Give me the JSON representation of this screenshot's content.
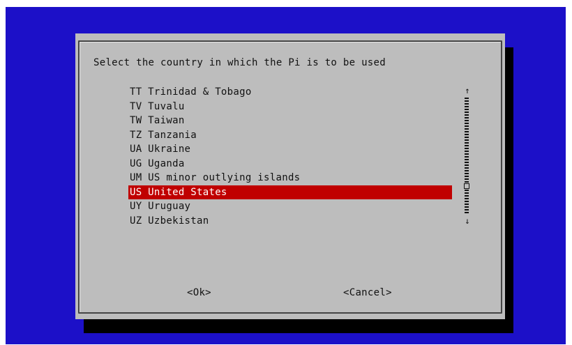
{
  "dialog": {
    "prompt": "Select the country in which the Pi is to be used",
    "items": [
      {
        "code": "TT",
        "name": "Trinidad & Tobago",
        "label": "TT Trinidad & Tobago"
      },
      {
        "code": "TV",
        "name": "Tuvalu",
        "label": "TV Tuvalu"
      },
      {
        "code": "TW",
        "name": "Taiwan",
        "label": "TW Taiwan"
      },
      {
        "code": "TZ",
        "name": "Tanzania",
        "label": "TZ Tanzania"
      },
      {
        "code": "UA",
        "name": "Ukraine",
        "label": "UA Ukraine"
      },
      {
        "code": "UG",
        "name": "Uganda",
        "label": "UG Uganda"
      },
      {
        "code": "UM",
        "name": "US minor outlying islands",
        "label": "UM US minor outlying islands"
      },
      {
        "code": "US",
        "name": "United States",
        "label": "US United States",
        "selected": true
      },
      {
        "code": "UY",
        "name": "Uruguay",
        "label": "UY Uruguay"
      },
      {
        "code": "UZ",
        "name": "Uzbekistan",
        "label": "UZ Uzbekistan"
      }
    ],
    "scrollbar": {
      "up": "↑",
      "down": "↓"
    },
    "buttons": {
      "ok": "<Ok>",
      "cancel": "<Cancel>"
    }
  },
  "colors": {
    "background": "#1c10c8",
    "dialog": "#bdbdbd",
    "selection": "#c00000",
    "shadow": "#000000"
  },
  "icons": {
    "scroll_up": "arrow-up-icon",
    "scroll_down": "arrow-down-icon",
    "scroll_thumb": "scroll-thumb-icon"
  }
}
